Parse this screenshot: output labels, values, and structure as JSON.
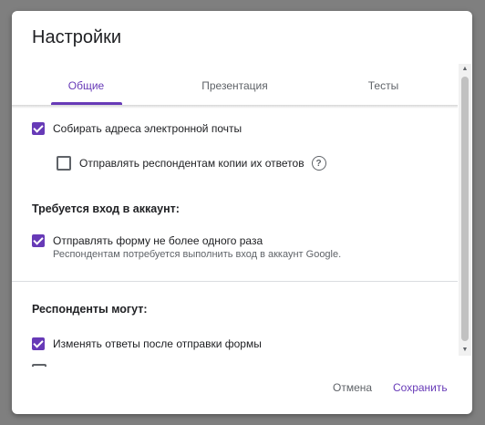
{
  "dialog": {
    "title": "Настройки",
    "tabs": [
      {
        "label": "Общие"
      },
      {
        "label": "Презентация"
      },
      {
        "label": "Тесты"
      }
    ]
  },
  "general": {
    "collect_emails": {
      "label": "Собирать адреса электронной почты",
      "checked": true
    },
    "send_copies": {
      "label": "Отправлять респондентам копии их ответов",
      "checked": false
    },
    "requires_signin_title": "Требуется вход в аккаунт:",
    "limit_one": {
      "label": "Отправлять форму не более одного раза",
      "sub": "Респондентам потребуется выполнить вход в аккаунт Google.",
      "checked": true
    },
    "respondents_can_title": "Респонденты могут:",
    "edit_after": {
      "label": "Изменять ответы после отправки формы",
      "checked": true
    }
  },
  "footer": {
    "cancel": "Отмена",
    "save": "Сохранить"
  },
  "colors": {
    "accent": "#673ab7"
  }
}
